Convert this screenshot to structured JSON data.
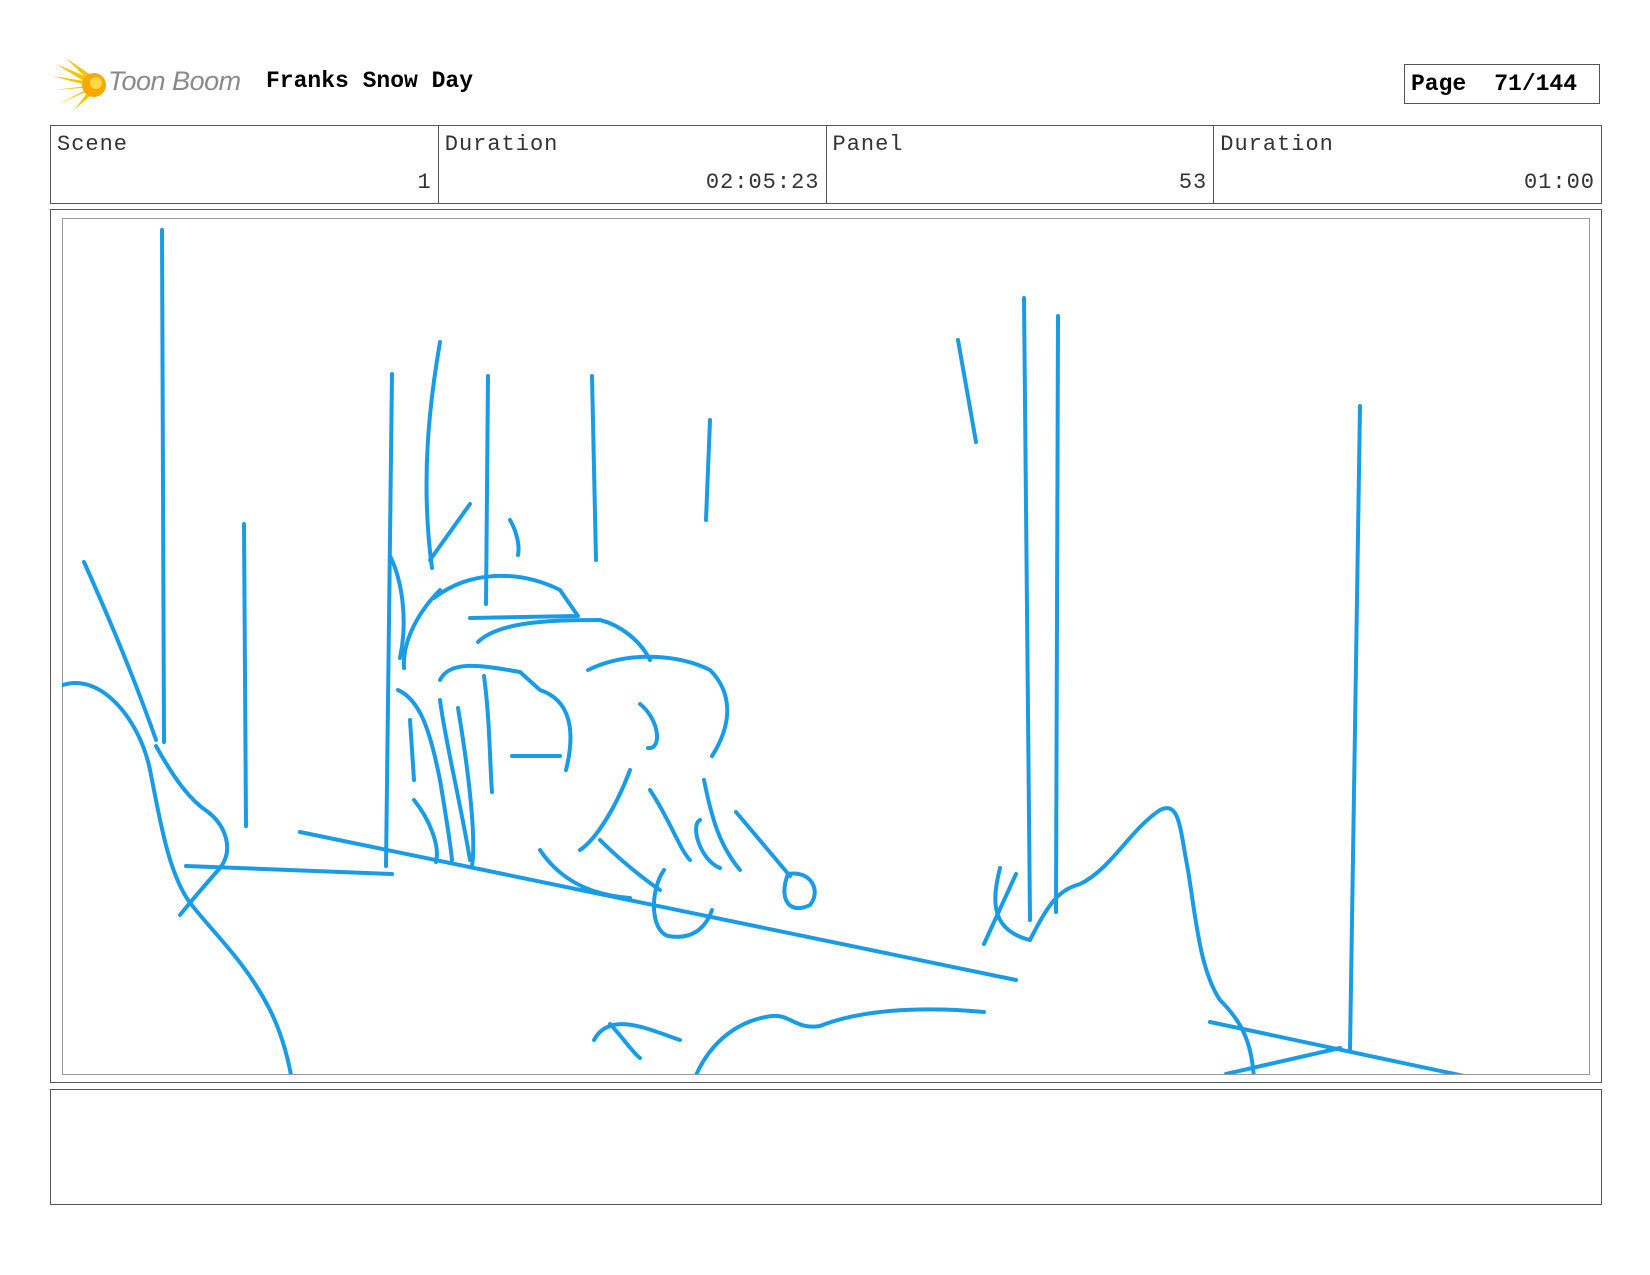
{
  "header": {
    "logo_text": "Toon Boom",
    "project_title": "Franks Snow Day",
    "page_label": "Page",
    "page_number": "71/144"
  },
  "info": {
    "scene_label": "Scene",
    "scene_value": "1",
    "scene_duration_label": "Duration",
    "scene_duration_value": "02:05:23",
    "panel_label": "Panel",
    "panel_value": "53",
    "panel_duration_label": "Duration",
    "panel_duration_value": "01:00"
  },
  "notes": {
    "text": ""
  },
  "colors": {
    "sketch": "#1a9be6",
    "logo_star": "#f5c400",
    "border": "#555555"
  },
  "icons": {
    "logo": "toon-boom-star-icon"
  }
}
